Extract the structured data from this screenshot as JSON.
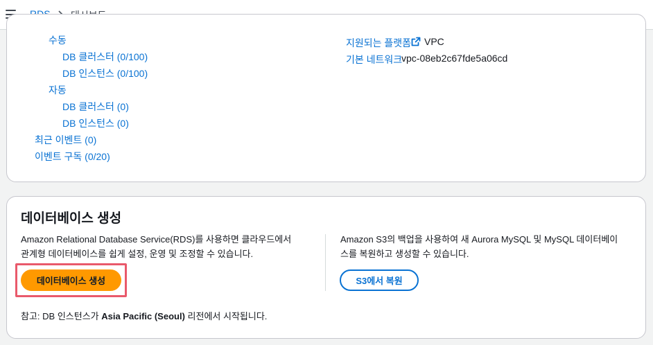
{
  "breadcrumb": {
    "root": "RDS",
    "current": "대시보드"
  },
  "resources": {
    "manual_label": "수동",
    "manual_clusters": "DB 클러스터 (0/100)",
    "manual_instances": "DB 인스턴스 (0/100)",
    "auto_label": "자동",
    "auto_clusters": "DB 클러스터 (0)",
    "auto_instances": "DB 인스턴스 (0)",
    "recent_events": "최근 이벤트 (0)",
    "event_subscriptions": "이벤트 구독 (0/20)"
  },
  "account": {
    "platforms_label": "지원되는 플랫폼",
    "platforms_value": "VPC",
    "network_label": "기본 네트워크",
    "network_value": "vpc-08eb2c67fde5a06cd"
  },
  "create_db": {
    "title": "데이터베이스 생성",
    "desc_line1": "Amazon Relational Database Service(RDS)를 사용하면 클라우드에서",
    "desc_line2": "관계형 데이터베이스를 쉽게 설정, 운영 및 조정할 수 있습니다.",
    "create_button": "데이터베이스 생성",
    "restore_desc_line1": "Amazon S3의 백업을 사용하여 새 Aurora MySQL 및 MySQL 데이터베이",
    "restore_desc_line2": "스를 복원하고 생성할 수 있습니다.",
    "restore_button": "S3에서 복원",
    "note_prefix": "참고: DB 인스턴스가",
    "note_region": "Asia Pacific (Seoul)",
    "note_suffix": "리전에서 시작됩니다."
  },
  "colors": {
    "link": "#0972d3",
    "primary_button": "#ff9900",
    "highlight": "#e9596b"
  }
}
